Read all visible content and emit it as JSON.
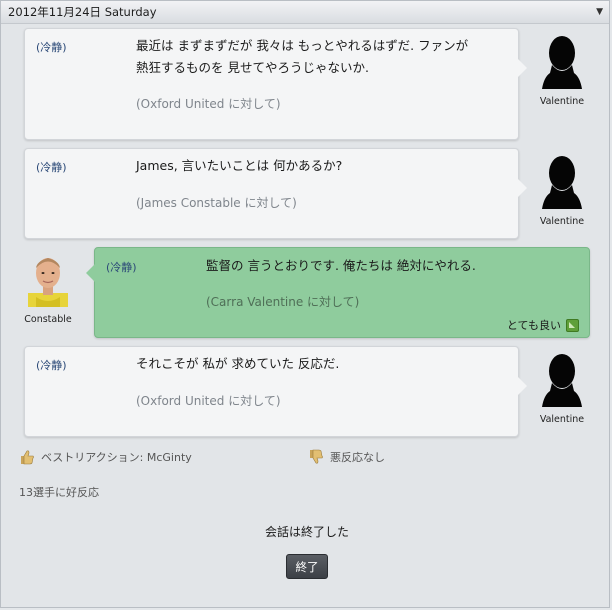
{
  "header": {
    "date": "2012年11月24日 Saturday"
  },
  "messages": [
    {
      "tone": "(冷静)",
      "line1": "最近は まずまずだが 我々は もっとやれるはずだ. ファンが",
      "line2": "熱狂するものを 見せてやろうじゃないか.",
      "target": "(Oxford United に対して)",
      "speaker": "Valentine"
    },
    {
      "tone": "(冷静)",
      "line1": "James, 言いたいことは 何かあるか?",
      "target": "(James Constable に対して)",
      "speaker": "Valentine"
    },
    {
      "tone": "(冷静)",
      "line1": "監督の 言うとおりです. 俺たちは 絶対にやれる.",
      "target": "(Carra Valentine に対して)",
      "speaker": "Constable",
      "rating": "とても良い"
    },
    {
      "tone": "(冷静)",
      "line1": "それこそが 私が 求めていた 反応だ.",
      "target": "(Oxford United に対して)",
      "speaker": "Valentine"
    }
  ],
  "summary": {
    "best_reaction": "ベストリアクション: McGinty",
    "bad_reaction": "悪反応なし",
    "positive_count": "13選手に好反応"
  },
  "footer": {
    "status": "会話は終了した",
    "end_button": "終了"
  },
  "colors": {
    "accent_green": "#8fcc9d",
    "button": "#4a4e54",
    "tone_text": "#2c4a78"
  }
}
